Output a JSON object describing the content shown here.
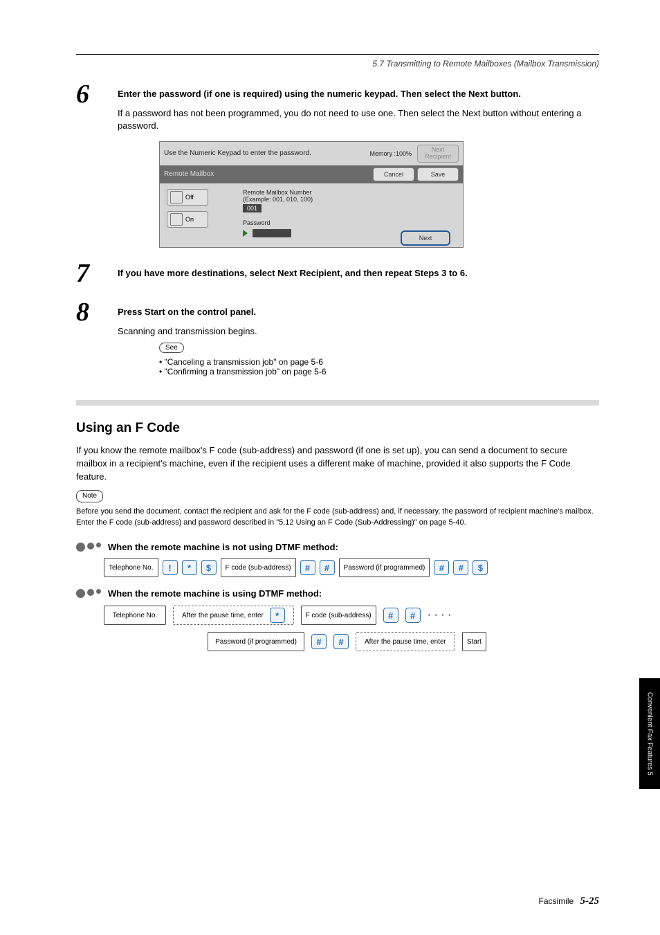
{
  "header": {
    "section_title": "5.7 Transmitting to Remote Mailboxes (Mailbox Transmission)"
  },
  "steps": {
    "s6": {
      "lead": "Enter the password (if one is required) using the numeric keypad. Then select the Next button.",
      "sub": "If a password has not been programmed, you do not need to use one. Then select the Next button without entering a password."
    },
    "s7": {
      "lead": "If you have more destinations, select Next Recipient, and then repeat Steps 3 to 6."
    },
    "s8": {
      "lead": "Press Start on the control panel.",
      "sub": "Scanning and transmission begins."
    }
  },
  "ui_panel": {
    "top_text": "Use the Numeric Keypad to enter the password.",
    "memory": "Memory :100%",
    "next_recipient": "Next\nRecipient",
    "bar_title": "Remote Mailbox",
    "cancel": "Cancel",
    "save": "Save",
    "off": "Off",
    "on": "On",
    "rmb_label": "Remote Mailbox Number",
    "rmb_example": "(Example: 001, 010, 100)",
    "rmb_value": "001",
    "password_label": "Password",
    "next": "Next"
  },
  "see": {
    "label": "See",
    "b1": "\"Canceling a transmission job\" on page 5-6",
    "b2": "\"Confirming a transmission job\" on page 5-6"
  },
  "section2": {
    "title": "Using an F Code",
    "p1": "If you know the remote mailbox's F code (sub-address) and password (if one is set up), you can send a document to secure mailbox in a recipient's machine, even if the recipient uses a different make of machine, provided it also supports the F Code feature.",
    "note_label": "Note",
    "note_text": "Before you send the document, contact the recipient and ask for the F code (sub-address) and, if necessary, the password of recipient machine's mailbox. Enter the F code (sub-address) and password described in \"5.12 Using an F Code (Sub-Addressing)\" on page 5-40.",
    "proc1_title": "When the remote machine is not using DTMF method:",
    "proc1_keys": {
      "slot1": "Telephone No.",
      "k1": "!",
      "k2": "*",
      "k3": "$",
      "slot2": "F code (sub-address)",
      "k4": "#",
      "k5": "#",
      "slot3": "Password (if programmed)",
      "k6": "#",
      "k7": "#",
      "k8": "$"
    },
    "proc2_title": "When the remote machine is using DTMF method:",
    "proc2": {
      "slot1": "Telephone No.",
      "dashed1": "After the pause time, enter",
      "k1": "*",
      "slot2": "F code (sub-address)",
      "k2": "#",
      "k3": "#",
      "dots": "· · · ·",
      "slot3": "Password (if programmed)",
      "k4": "#",
      "k5": "#",
      "dashed2": "After the pause time, enter",
      "slot4": "Start"
    }
  },
  "side_tab": "Convenient Fax Features    5",
  "footer": {
    "text": "Facsimile",
    "page": "5-25"
  }
}
